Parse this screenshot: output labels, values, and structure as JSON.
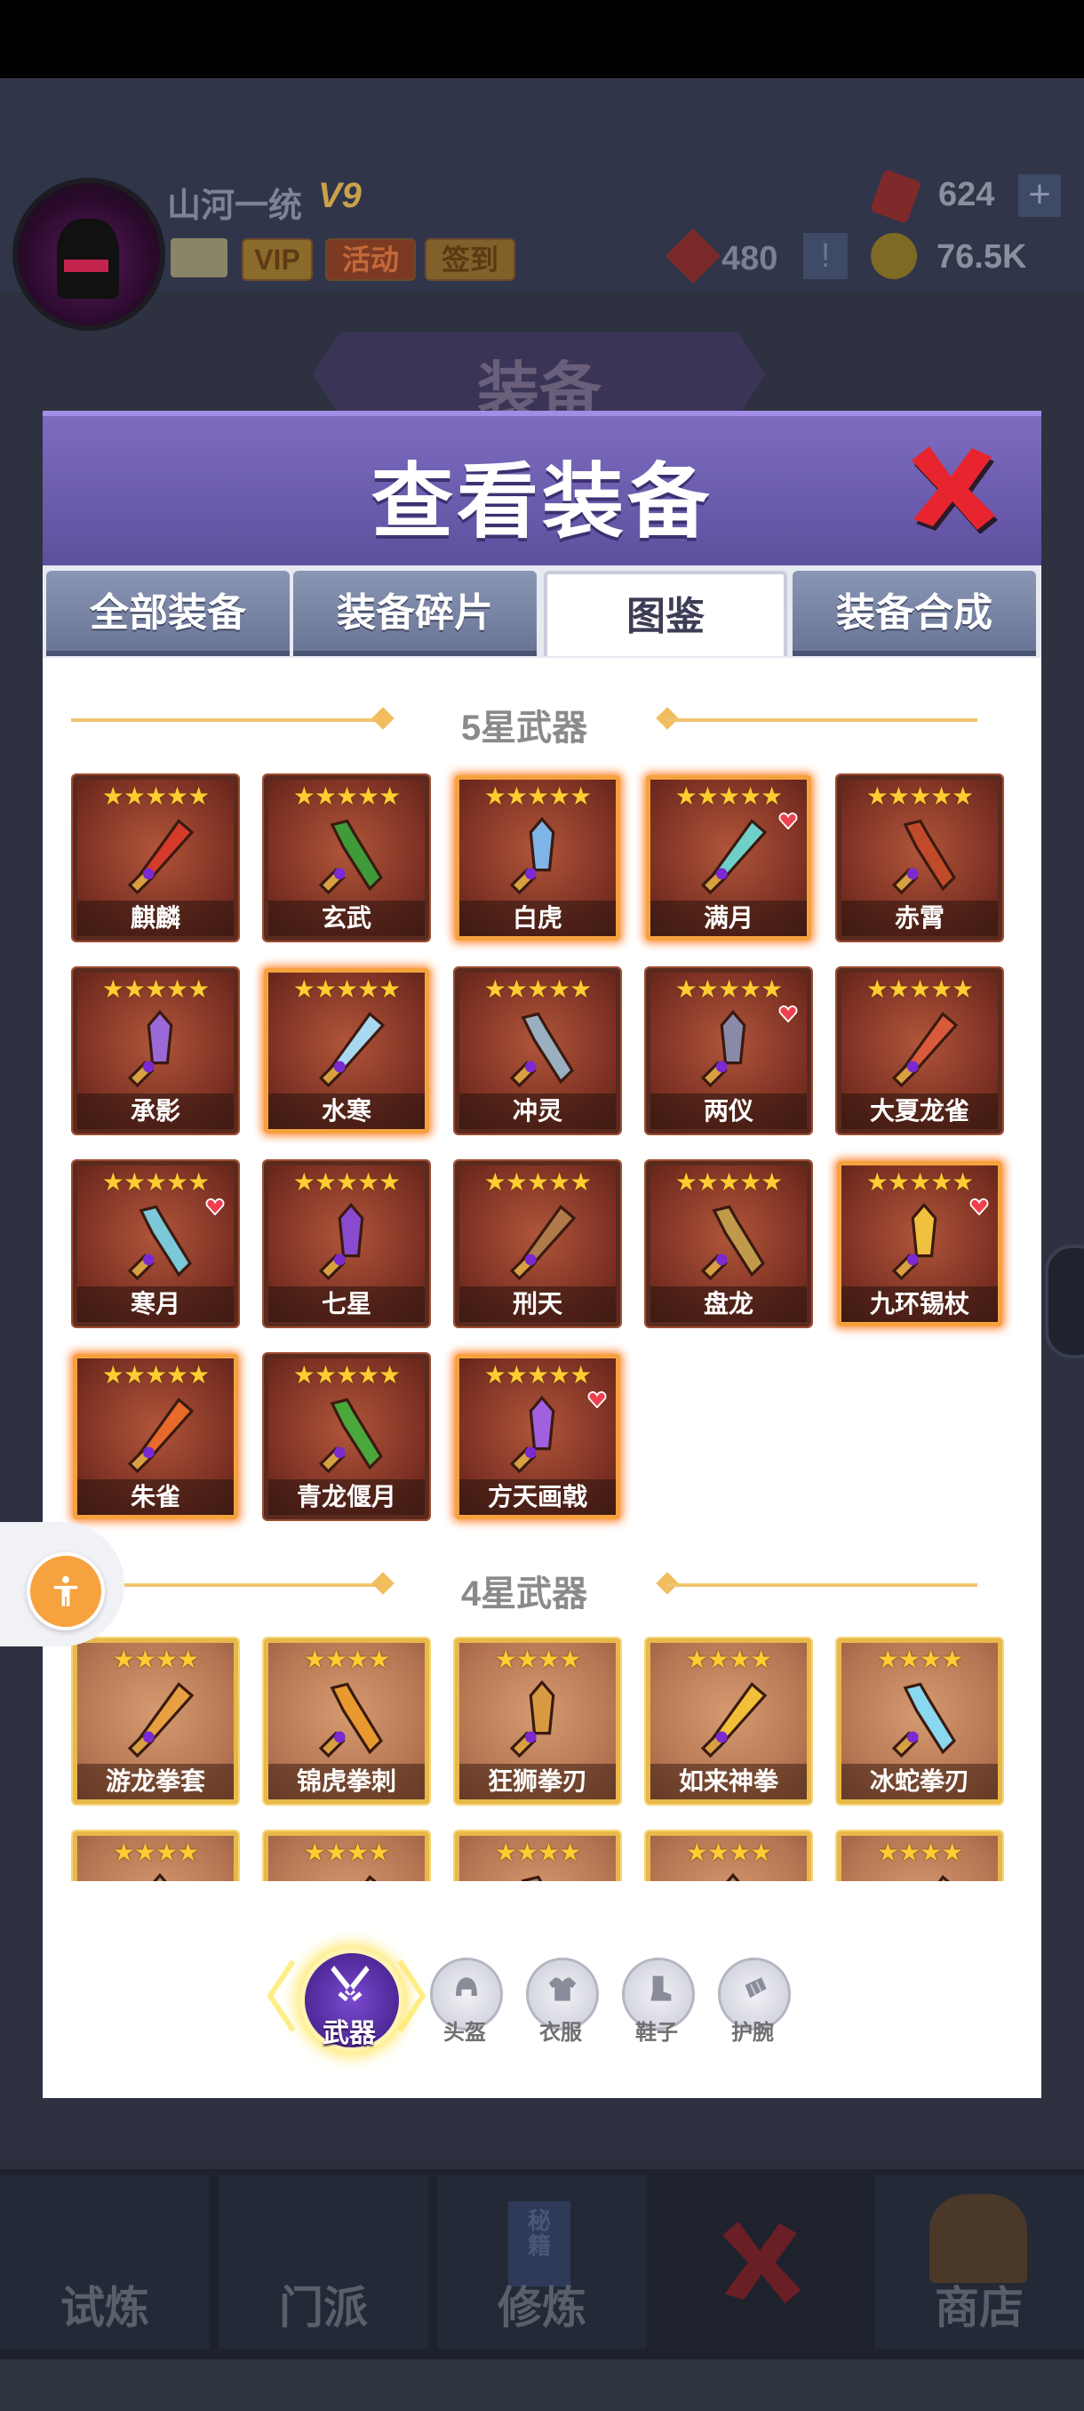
{
  "player": {
    "name": "山河一统",
    "vip_level": "V9"
  },
  "top_buttons": {
    "vip": "VIP",
    "activity": "活动",
    "sign_in": "签到",
    "plus": "+",
    "alert": "!"
  },
  "currency": {
    "rubies": "624",
    "tokens": "480",
    "coins": "76.5K"
  },
  "background_title": "装备",
  "dialog": {
    "title": "查看装备",
    "tabs": [
      {
        "label": "全部装备",
        "active": false
      },
      {
        "label": "装备碎片",
        "active": false
      },
      {
        "label": "图鉴",
        "active": true
      },
      {
        "label": "装备合成",
        "active": false
      }
    ]
  },
  "sections": {
    "five_star": {
      "title": "5星武器",
      "stars": "★★★★★",
      "items": [
        {
          "name": "麒麟",
          "highlight": false,
          "heart": false,
          "color": "#d63a2a"
        },
        {
          "name": "玄武",
          "highlight": false,
          "heart": false,
          "color": "#3f9a3a"
        },
        {
          "name": "白虎",
          "highlight": true,
          "heart": false,
          "color": "#7fb4e8"
        },
        {
          "name": "满月",
          "highlight": true,
          "heart": true,
          "color": "#6ed0c8"
        },
        {
          "name": "赤霄",
          "highlight": false,
          "heart": false,
          "color": "#c04a2a"
        },
        {
          "name": "承影",
          "highlight": false,
          "heart": false,
          "color": "#9b6ad8"
        },
        {
          "name": "水寒",
          "highlight": true,
          "heart": false,
          "color": "#a8d8f0"
        },
        {
          "name": "冲灵",
          "highlight": false,
          "heart": false,
          "color": "#9ab0c0"
        },
        {
          "name": "两仪",
          "highlight": false,
          "heart": true,
          "color": "#8a8aa8"
        },
        {
          "name": "大夏龙雀",
          "highlight": false,
          "heart": false,
          "color": "#d85a3a"
        },
        {
          "name": "寒月",
          "highlight": false,
          "heart": true,
          "color": "#7ac8d8"
        },
        {
          "name": "七星",
          "highlight": false,
          "heart": false,
          "color": "#8a4ad0"
        },
        {
          "name": "刑天",
          "highlight": false,
          "heart": false,
          "color": "#b07a4a"
        },
        {
          "name": "盘龙",
          "highlight": false,
          "heart": false,
          "color": "#c09a4a"
        },
        {
          "name": "九环锡杖",
          "highlight": true,
          "heart": true,
          "color": "#f0c040"
        },
        {
          "name": "朱雀",
          "highlight": true,
          "heart": false,
          "color": "#e86a2a"
        },
        {
          "name": "青龙偃月",
          "highlight": false,
          "heart": false,
          "color": "#4aa83a"
        },
        {
          "name": "方天画戟",
          "highlight": true,
          "heart": true,
          "color": "#a060e0"
        }
      ]
    },
    "four_star": {
      "title": "4星武器",
      "stars": "★★★★",
      "items": [
        {
          "name": "游龙拳套",
          "color": "#e8a040"
        },
        {
          "name": "锦虎拳刺",
          "color": "#e89a30"
        },
        {
          "name": "狂狮拳刃",
          "color": "#d89a40"
        },
        {
          "name": "如来神拳",
          "color": "#f2c038"
        },
        {
          "name": "冰蛇拳刃",
          "color": "#8ad8f0"
        },
        {
          "name": "",
          "color": "#a89070"
        },
        {
          "name": "",
          "color": "#a89070"
        },
        {
          "name": "",
          "color": "#a89070"
        },
        {
          "name": "",
          "color": "#a89070"
        },
        {
          "name": "",
          "color": "#a89070"
        }
      ]
    }
  },
  "categories": [
    {
      "label": "武器",
      "icon": "crossed-swords-icon",
      "active": true
    },
    {
      "label": "头盔",
      "icon": "helmet-icon",
      "active": false
    },
    {
      "label": "衣服",
      "icon": "armor-icon",
      "active": false
    },
    {
      "label": "鞋子",
      "icon": "boot-icon",
      "active": false
    },
    {
      "label": "护腕",
      "icon": "bracer-icon",
      "active": false
    }
  ],
  "bottom_nav": {
    "items": [
      {
        "label": "试炼"
      },
      {
        "label": "门派"
      },
      {
        "label": "修炼"
      },
      {
        "label": ""
      },
      {
        "label": "商店"
      }
    ],
    "book_label": "秘籍"
  },
  "colors": {
    "header_purple": "#6e5db0",
    "accent_gold": "#f1c470",
    "close_red": "#e8242e"
  }
}
